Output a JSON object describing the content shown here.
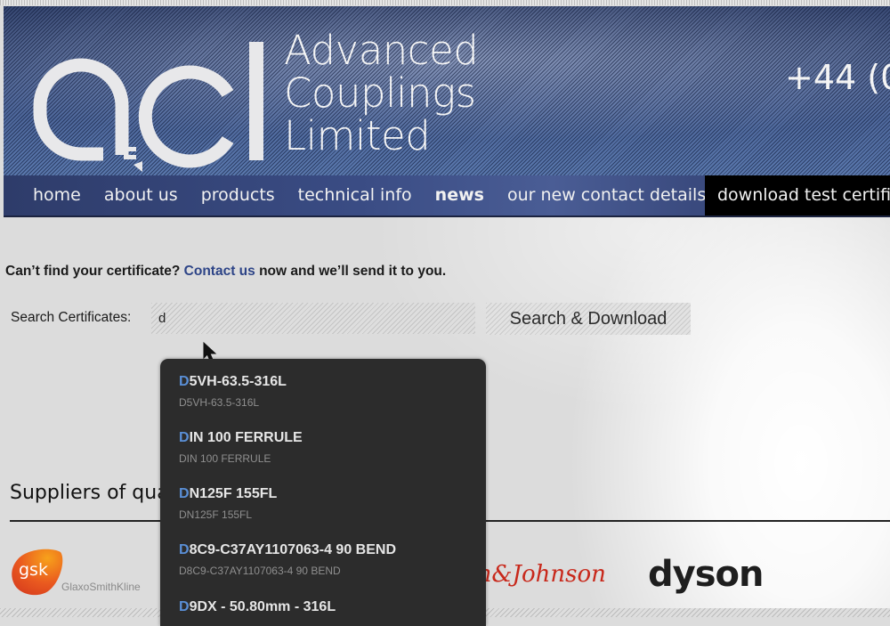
{
  "header": {
    "logo_mark": "acl",
    "company_name_lines": [
      "Advanced",
      "Couplings",
      "Limited"
    ],
    "phone_partial": "+44 (0"
  },
  "nav": {
    "items": [
      {
        "label": "home"
      },
      {
        "label": "about us"
      },
      {
        "label": "products"
      },
      {
        "label": "technical info"
      },
      {
        "label": "news"
      },
      {
        "label": "our new contact details"
      },
      {
        "label": "download test certific"
      }
    ],
    "active_index": 6
  },
  "notice": {
    "before": "Can’t find your certificate? ",
    "link": "Contact us",
    "after": " now and we’ll send it to you."
  },
  "search": {
    "label": "Search Certificates:",
    "value": "d",
    "button_label": "Search & Download"
  },
  "autocomplete": {
    "query_highlight": "D",
    "items": [
      {
        "rest": "5VH-63.5-316L",
        "sub": "D5VH-63.5-316L"
      },
      {
        "rest": "IN 100 FERRULE",
        "sub": "DIN 100 FERRULE"
      },
      {
        "rest": "N125F 155FL",
        "sub": "DN125F 155FL"
      },
      {
        "rest": "8C9-C37AY1107063-4 90 BEND",
        "sub": "D8C9-C37AY1107063-4 90 BEND"
      },
      {
        "rest": "9DX - 50.80mm - 316L",
        "sub": ""
      }
    ]
  },
  "suppliers": {
    "title_partial": "Suppliers of qua",
    "logos": [
      {
        "name": "gsk",
        "text": "gsk",
        "subtext": "GlaxoSmithKline"
      },
      {
        "name": "johnson-and-johnson",
        "text": "on&Johnson"
      },
      {
        "name": "dyson",
        "text": "dyson"
      }
    ]
  },
  "colors": {
    "header_blue": "#4a6295",
    "nav_blue": "#3a4c84",
    "link_blue": "#2d4487",
    "highlight_blue": "#5a8fd6",
    "dropdown_bg": "#2c2c2c",
    "gsk_orange": "#e8571f",
    "jj_red": "#c8281b"
  }
}
